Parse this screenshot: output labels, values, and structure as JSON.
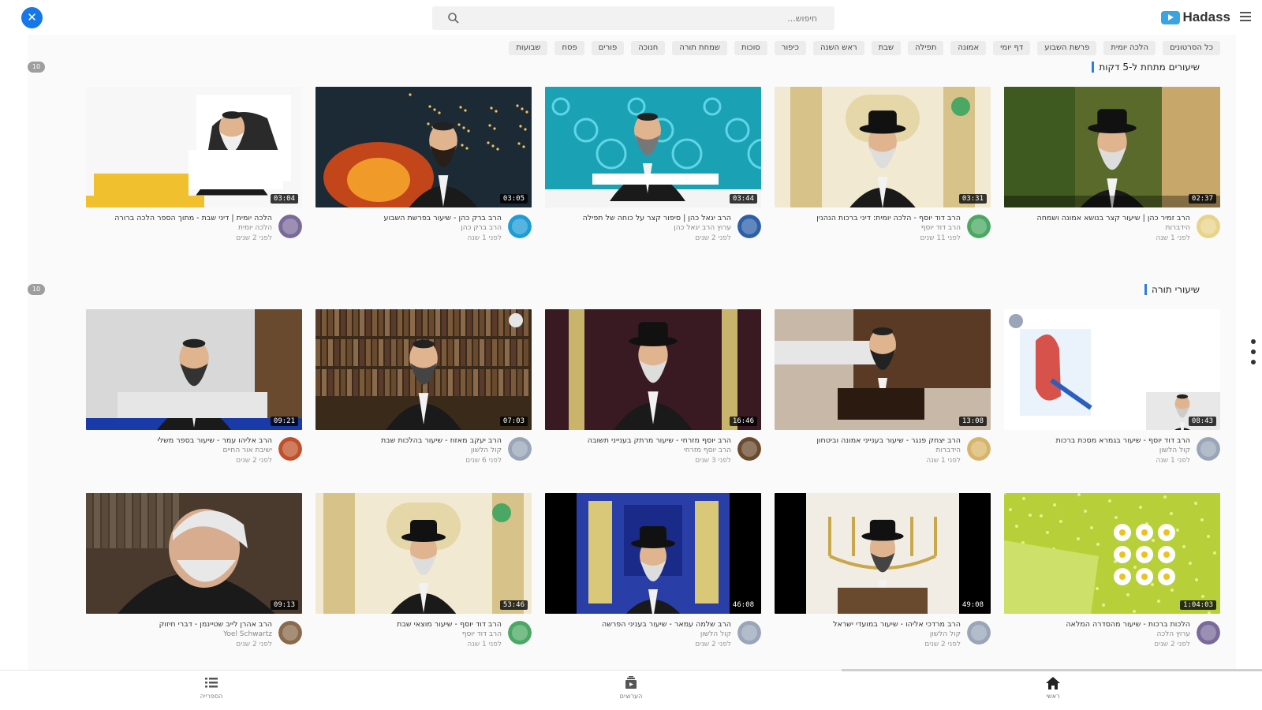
{
  "topbar": {
    "close_symbol": "✕",
    "search_placeholder": "חיפוש...",
    "brand_name": "Hadass"
  },
  "chips": [
    "כל הסרטונים",
    "הלכה יומית",
    "פרשת השבוע",
    "דף יומי",
    "אמונה",
    "תפילה",
    "שבת",
    "ראש השנה",
    "כיפור",
    "סוכות",
    "שמחת תורה",
    "חנוכה",
    "פורים",
    "פסח",
    "שבועות"
  ],
  "sections": [
    {
      "title": "שיעורים מתחת ל-5 דקות",
      "count": "10",
      "videos": [
        {
          "duration": "02:37",
          "title": "הרב זמיר כהן | שיעור קצר בנושא אמונה ושמחה",
          "channel": "הידברות",
          "age": "לפני 1 שנה",
          "avatar_color": "#e8d38a",
          "thumb": "garden"
        },
        {
          "duration": "03:31",
          "title": "הרב דוד יוסף - הלכה יומית: דיני ברכות הנהנין",
          "channel": "הרב דוד יוסף",
          "age": "לפני 11 שנים",
          "avatar_color": "#4aa864",
          "thumb": "gold"
        },
        {
          "duration": "03:44",
          "title": "הרב יגאל כהן | סיפור קצר על כוחה של תפילה",
          "channel": "ערוץ הרב יגאל כהן",
          "age": "לפני 2 שנים",
          "avatar_color": "#2d5fa8",
          "thumb": "teal"
        },
        {
          "duration": "03:05",
          "title": "הרב ברק כהן - שיעור בפרשת השבוע",
          "channel": "הרב ברק כהן",
          "age": "לפני 1 שנה",
          "avatar_color": "#1e9cd6",
          "thumb": "fire"
        },
        {
          "duration": "03:04",
          "title": "הלכה יומית | דיני שבת - מתוך הספר הלכה ברורה",
          "channel": "הלכה יומית",
          "age": "לפני 2 שנים",
          "avatar_color": "#7a6a9a",
          "thumb": "white"
        }
      ]
    },
    {
      "title": "שיעורי תורה",
      "count": "10",
      "videos": [
        {
          "duration": "08:43",
          "title": "הרב דוד יוסף - שיעור בגמרא מסכת ברכות",
          "channel": "קול הלשון",
          "age": "לפני 1 שנה",
          "avatar_color": "#9aa6b8",
          "thumb": "diagram"
        },
        {
          "duration": "13:08",
          "title": "הרב יצחק פנגר - שיעור בענייני אמונה וביטחון",
          "channel": "הידברות",
          "age": "לפני 1 שנה",
          "avatar_color": "#d8b46a",
          "thumb": "podium"
        },
        {
          "duration": "16:46",
          "title": "הרב יוסף מזרחי - שיעור מרתק בענייני תשובה",
          "channel": "הרב יוסף מזרחי",
          "age": "לפני 3 שנים",
          "avatar_color": "#6b4a2e",
          "thumb": "stage"
        },
        {
          "duration": "07:03",
          "title": "הרב יעקב מאזוז - שיעור בהלכות שבת",
          "channel": "קול הלשון",
          "age": "לפני 6 שנים",
          "avatar_color": "#9aa6b8",
          "thumb": "books"
        },
        {
          "duration": "09:21",
          "title": "הרב אליהו עמר - שיעור בספר משלי",
          "channel": "ישיבת אור החיים",
          "age": "לפני 2 שנים",
          "avatar_color": "#c0502a",
          "thumb": "office"
        }
      ]
    },
    {
      "title": "",
      "count": "",
      "videos": [
        {
          "duration": "1:04:03",
          "title": "הלכות ברכות - שיעור מהסדרה המלאה",
          "channel": "ערוץ הלכה",
          "age": "לפני 2 שנים",
          "avatar_color": "#7a6a9a",
          "thumb": "gift"
        },
        {
          "duration": "49:08",
          "title": "הרב מרדכי אליהו - שיעור במועדי ישראל",
          "channel": "קול הלשון",
          "age": "לפני 2 שנים",
          "avatar_color": "#9aa6b8",
          "thumb": "menorah"
        },
        {
          "duration": "46:08",
          "title": "הרב שלמה עמאר - שיעור בעניני הפרשה",
          "channel": "קול הלשון",
          "age": "לפני 2 שנים",
          "avatar_color": "#9aa6b8",
          "thumb": "ark"
        },
        {
          "duration": "53:46",
          "title": "הרב דוד יוסף - שיעור מוצאי שבת",
          "channel": "הרב דוד יוסף",
          "age": "לפני 1 שנה",
          "avatar_color": "#4aa864",
          "thumb": "gold2"
        },
        {
          "duration": "09:13",
          "title": "הרב אהרן לייב שטיינמן - דברי חיזוק",
          "channel": "Yoel Schwartz",
          "age": "לפני 2 שנים",
          "avatar_color": "#8a6a4a",
          "thumb": "elder"
        }
      ]
    }
  ],
  "bottom_nav": [
    {
      "label": "ראשי",
      "icon": "home-icon"
    },
    {
      "label": "הערוצים",
      "icon": "channels-icon"
    },
    {
      "label": "הספרייה",
      "icon": "library-icon"
    }
  ]
}
